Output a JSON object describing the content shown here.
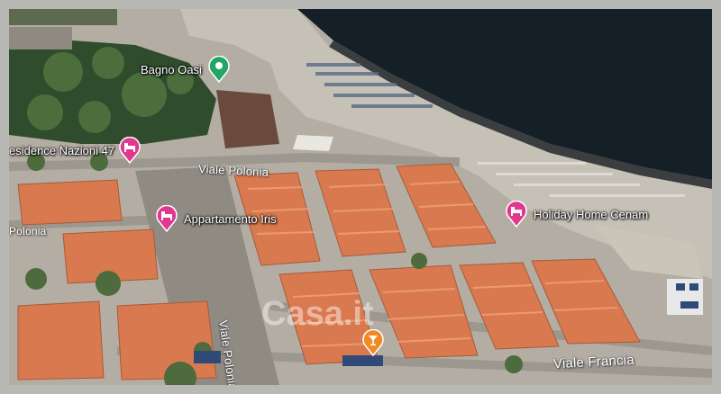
{
  "map": {
    "type": "satellite",
    "colors": {
      "sea": "#152026",
      "beach": "#c6c1b6",
      "roofs": "#d9794f",
      "vegetation": "#3b5b36",
      "pin_green": "#22a565",
      "pin_pink": "#e0388f",
      "pin_orange": "#f08a24"
    }
  },
  "pois": [
    {
      "name": "Bagno Oasi",
      "icon": "beach-pin-icon"
    },
    {
      "name": "esidence Nazioni 47",
      "icon": "hotel-pin-icon"
    },
    {
      "name": "Appartamento Iris",
      "icon": "hotel-pin-icon"
    },
    {
      "name": "Holiday Home Cenam",
      "icon": "hotel-pin-icon"
    },
    {
      "name": "",
      "icon": "bar-pin-icon"
    }
  ],
  "streets": {
    "viale_polonia_top": "Viale Polonia",
    "polonia_left": "Polonia",
    "viale_polonia_vertical": "Viale Polonia",
    "viale_francia": "Viale Francia"
  },
  "watermark": "Casa.it"
}
